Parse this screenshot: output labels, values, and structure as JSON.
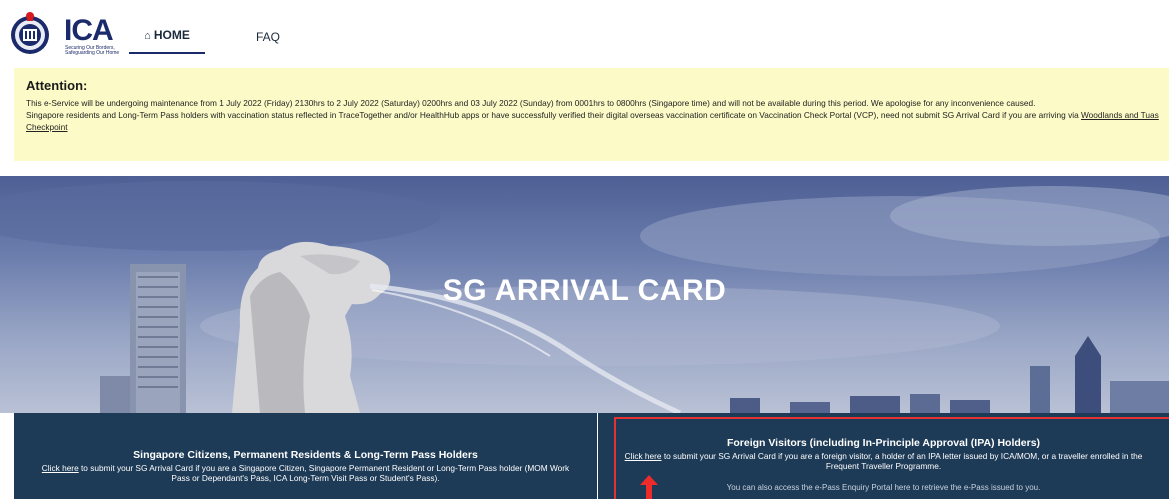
{
  "header": {
    "logo_text": "ICA",
    "logo_tagline": "Securing Our Borders, Safeguarding Our Home",
    "nav": [
      {
        "label": "HOME",
        "active": true
      },
      {
        "label": "FAQ",
        "active": false
      }
    ]
  },
  "attention": {
    "title": "Attention:",
    "message1": "This e-Service will be undergoing maintenance from 1 July 2022 (Friday) 2130hrs to 2 July 2022 (Saturday) 0200hrs and 03 July 2022 (Sunday) from 0001hrs to 0800hrs (Singapore time) and will not be available during this period. We apologise for any inconvenience caused.",
    "message2_pre": "Singapore residents and Long-Term Pass holders with vaccination status reflected in TraceTogether and/or HealthHub apps or have successfully verified their digital overseas vaccination certificate on Vaccination Check Portal (VCP), need not submit SG Arrival Card if you are arriving via ",
    "message2_link": "Woodlands and Tuas Checkpoint",
    "background": "#fcfbc7"
  },
  "hero": {
    "title": "SG ARRIVAL CARD"
  },
  "cards": {
    "left": {
      "title": "Singapore Citizens, Permanent Residents & Long-Term Pass Holders",
      "link": "Click here",
      "desc": " to submit your SG Arrival Card if you are a Singapore Citizen, Singapore Permanent Resident or Long-Term Pass holder (MOM Work Pass or Dependant's Pass, ICA Long-Term Visit Pass or Student's Pass)."
    },
    "right": {
      "title": "Foreign Visitors (including In-Principle Approval (IPA) Holders)",
      "link": "Click here",
      "desc": " to submit your SG Arrival Card if you are a foreign visitor, a holder of an IPA letter issued by ICA/MOM, or a traveller enrolled in the Frequent Traveller Programme.",
      "extra": "You can also access the e-Pass Enquiry Portal here to retrieve the e-Pass issued to you."
    },
    "background": "#1d3a56",
    "highlight_color": "#e23232"
  },
  "icons": [
    "ica-emblem-icon",
    "home-icon",
    "red-arrow-icon"
  ]
}
